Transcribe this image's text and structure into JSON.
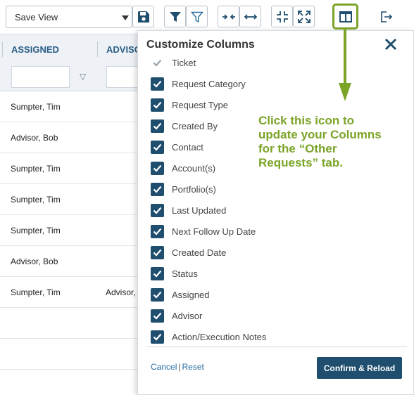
{
  "toolbar": {
    "view_select": "Save View",
    "icons": [
      "save-icon",
      "filter-icon",
      "filter-outline-icon",
      "collapse-horizontal-icon",
      "expand-horizontal-icon",
      "compress-icon",
      "expand-icon",
      "columns-icon",
      "export-icon"
    ]
  },
  "table": {
    "columns": [
      "ASSIGNED",
      "ADVISO"
    ],
    "filter_symbol": "▽",
    "rows": [
      {
        "assigned": "Sumpter, Tim",
        "advisor": ""
      },
      {
        "assigned": "Advisor, Bob",
        "advisor": ""
      },
      {
        "assigned": "Sumpter, Tim",
        "advisor": ""
      },
      {
        "assigned": "Sumpter, Tim",
        "advisor": ""
      },
      {
        "assigned": "Sumpter, Tim",
        "advisor": ""
      },
      {
        "assigned": "Advisor, Bob",
        "advisor": ""
      },
      {
        "assigned": "Sumpter, Tim",
        "advisor": "Advisor,"
      },
      {
        "assigned": "",
        "advisor": ""
      },
      {
        "assigned": "",
        "advisor": ""
      }
    ]
  },
  "panel": {
    "title": "Customize Columns",
    "close_label": "✕",
    "items": [
      {
        "label": "Ticket",
        "checked": true,
        "disabled": true
      },
      {
        "label": "Request Category",
        "checked": true,
        "disabled": false
      },
      {
        "label": "Request Type",
        "checked": true,
        "disabled": false
      },
      {
        "label": "Created By",
        "checked": true,
        "disabled": false
      },
      {
        "label": "Contact",
        "checked": true,
        "disabled": false
      },
      {
        "label": "Account(s)",
        "checked": true,
        "disabled": false
      },
      {
        "label": "Portfolio(s)",
        "checked": true,
        "disabled": false
      },
      {
        "label": "Last Updated",
        "checked": true,
        "disabled": false
      },
      {
        "label": "Next Follow Up Date",
        "checked": true,
        "disabled": false
      },
      {
        "label": "Created Date",
        "checked": true,
        "disabled": false
      },
      {
        "label": "Status",
        "checked": true,
        "disabled": false
      },
      {
        "label": "Assigned",
        "checked": true,
        "disabled": false
      },
      {
        "label": "Advisor",
        "checked": true,
        "disabled": false
      },
      {
        "label": "Action/Execution Notes",
        "checked": true,
        "disabled": false
      }
    ],
    "cancel_label": "Cancel",
    "separator": "|",
    "reset_label": "Reset",
    "confirm_label": "Confirm & Reload"
  },
  "annotation": {
    "text": "Click this icon to\nupdate your Columns\nfor the “Other\nRequests” tab."
  },
  "colors": {
    "accent_green": "#7ba428",
    "primary_navy": "#1f4e6e",
    "header_blue": "#2a5d86",
    "link_blue": "#2a6fa3"
  }
}
